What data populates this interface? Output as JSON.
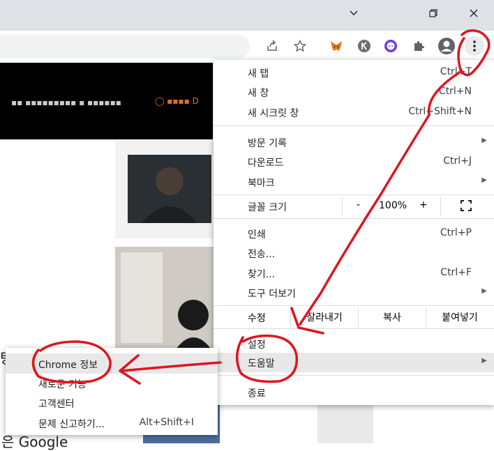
{
  "titlebar": {
    "icons": [
      "chevron-down-icon",
      "restore-icon",
      "close-icon"
    ]
  },
  "toolbar": {
    "icons": [
      "share-icon",
      "star-icon",
      "metamask-icon",
      "klip-icon",
      "extension-icon-2",
      "puzzle-icon",
      "profile-icon",
      "kebab-icon"
    ]
  },
  "page": {
    "partial_text_top": "탕",
    "partial_text_bottom": "은 Google"
  },
  "menu": {
    "new_tab": {
      "label": "새 탭",
      "shortcut": "Ctrl+T"
    },
    "new_window": {
      "label": "새 창",
      "shortcut": "Ctrl+N"
    },
    "incognito": {
      "label": "새 시크릿 창",
      "shortcut": "Ctrl+Shift+N"
    },
    "history": {
      "label": "방문 기록"
    },
    "downloads": {
      "label": "다운로드",
      "shortcut": "Ctrl+J"
    },
    "bookmarks": {
      "label": "북마크"
    },
    "zoom": {
      "label": "글꼴 크기",
      "minus": "-",
      "value": "100%",
      "plus": "+"
    },
    "print": {
      "label": "인쇄",
      "shortcut": "Ctrl+P"
    },
    "cast": {
      "label": "전송..."
    },
    "find": {
      "label": "찾기...",
      "shortcut": "Ctrl+F"
    },
    "more_tools": {
      "label": "도구 더보기"
    },
    "edit": {
      "label": "수정",
      "cut": "잘라내기",
      "copy": "복사",
      "paste": "붙여넣기"
    },
    "settings": {
      "label": "설정"
    },
    "help": {
      "label": "도움말"
    },
    "exit": {
      "label": "종료"
    }
  },
  "submenu": {
    "about": {
      "label": "Chrome 정보"
    },
    "whats_new": {
      "label": "새로운 기능"
    },
    "help_center": {
      "label": "고객센터"
    },
    "report": {
      "label": "문제 신고하기...",
      "shortcut": "Alt+Shift+I"
    }
  },
  "colors": {
    "annotation": "#e0141e",
    "menu_hover": "#e8e8e8",
    "titlebar": "#dee1e6"
  }
}
